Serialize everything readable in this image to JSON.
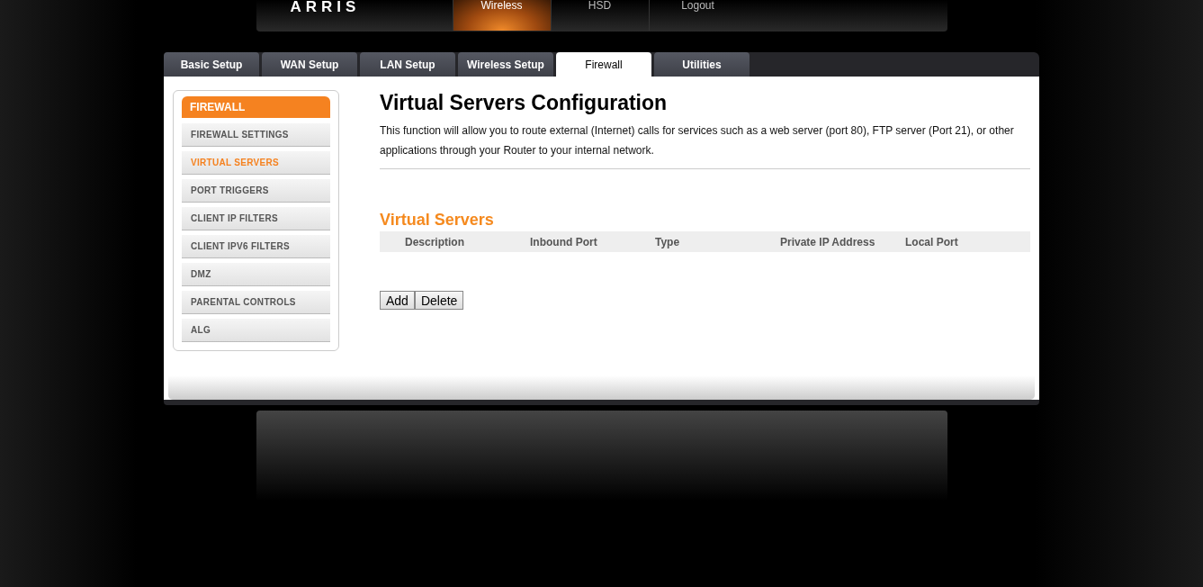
{
  "header": {
    "logo": "ARRIS",
    "nav": [
      {
        "label": "Wireless",
        "selected": true
      },
      {
        "label": "HSD",
        "selected": false
      },
      {
        "label": "Logout",
        "selected": false
      }
    ]
  },
  "tabs": [
    {
      "label": "Basic Setup",
      "selected": false
    },
    {
      "label": "WAN Setup",
      "selected": false
    },
    {
      "label": "LAN Setup",
      "selected": false
    },
    {
      "label": "Wireless Setup",
      "selected": false
    },
    {
      "label": "Firewall",
      "selected": true
    },
    {
      "label": "Utilities",
      "selected": false
    }
  ],
  "sidebar": {
    "title": "FIREWALL",
    "items": [
      {
        "label": "FIREWALL SETTINGS",
        "selected": false
      },
      {
        "label": "VIRTUAL SERVERS",
        "selected": true
      },
      {
        "label": "PORT TRIGGERS",
        "selected": false
      },
      {
        "label": "CLIENT IP FILTERS",
        "selected": false
      },
      {
        "label": "CLIENT IPV6 FILTERS",
        "selected": false
      },
      {
        "label": "DMZ",
        "selected": false
      },
      {
        "label": "PARENTAL CONTROLS",
        "selected": false
      },
      {
        "label": "ALG",
        "selected": false
      }
    ]
  },
  "content": {
    "title": "Virtual Servers Configuration",
    "description": "This function will allow you to route external (Internet) calls for services such as a web server (port 80), FTP server (Port 21), or other applications through your Router to your internal network.",
    "section_title": "Virtual Servers",
    "table": {
      "columns": [
        "Description",
        "Inbound Port",
        "Type",
        "Private IP Address",
        "Local Port"
      ]
    },
    "buttons": [
      "Add",
      "Delete"
    ]
  }
}
